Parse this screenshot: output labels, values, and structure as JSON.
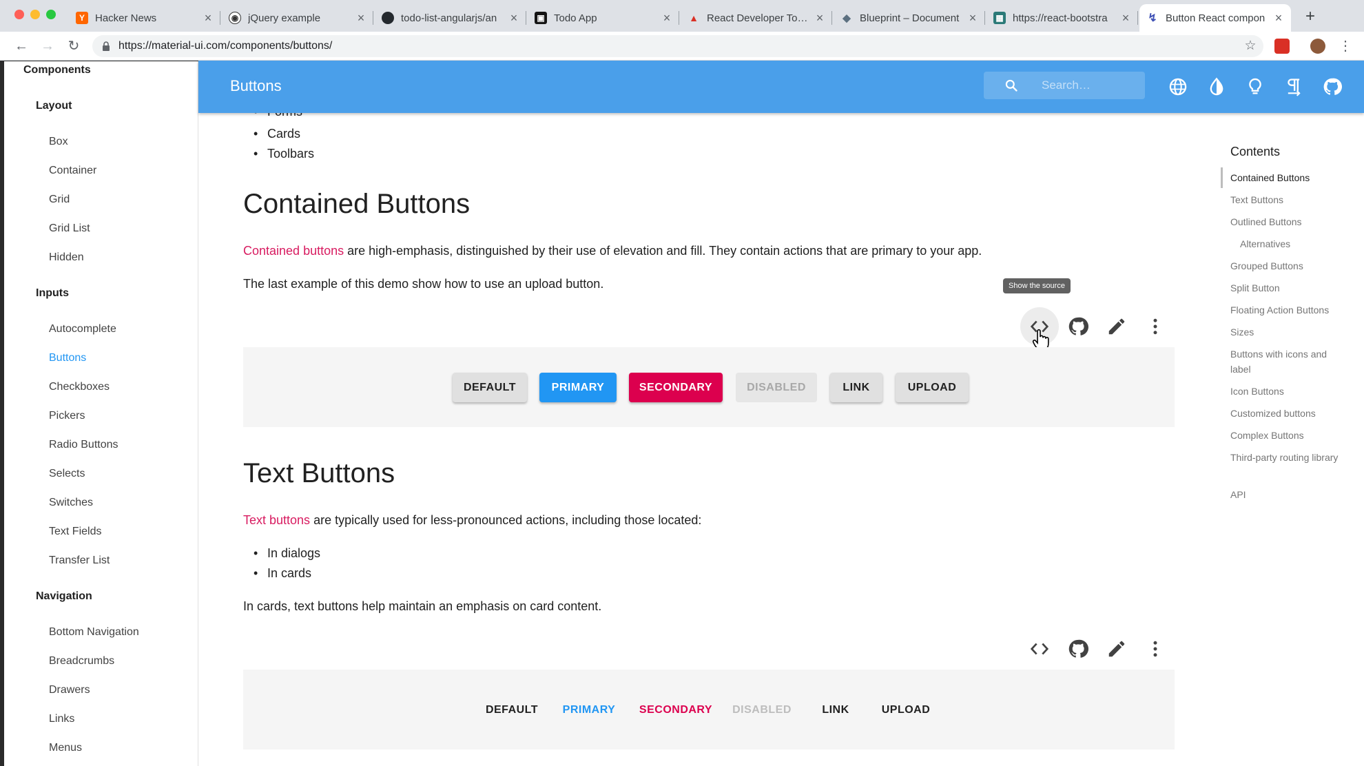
{
  "browser": {
    "tabs": [
      {
        "title": "Hacker News",
        "favicon": "hacker-news-icon",
        "color": "#ff6600",
        "glyph": "Y"
      },
      {
        "title": "jQuery example",
        "favicon": "codepen-icon",
        "color": "#333333",
        "glyph": "◉"
      },
      {
        "title": "todo-list-angularjs/an",
        "favicon": "github-icon",
        "color": "#24292e",
        "glyph": "●"
      },
      {
        "title": "Todo App",
        "favicon": "codesandbox-icon",
        "color": "#151515",
        "glyph": "▣"
      },
      {
        "title": "React Developer Tools",
        "favicon": "chrome-store-icon",
        "color": "#d93025",
        "glyph": "▲"
      },
      {
        "title": "Blueprint – Document",
        "favicon": "blueprint-icon",
        "color": "#5c7080",
        "glyph": "◆"
      },
      {
        "title": "https://react-bootstra",
        "favicon": "react-bootstrap-icon",
        "color": "#2b7a78",
        "glyph": "▦"
      },
      {
        "title": "Button React compon",
        "favicon": "material-ui-icon",
        "color": "#3f51b5",
        "glyph": "↯"
      }
    ],
    "url": "https://material-ui.com/components/buttons/"
  },
  "sidebar": {
    "top_label": "Components",
    "groups": [
      {
        "label": "Layout",
        "items": [
          "Box",
          "Container",
          "Grid",
          "Grid List",
          "Hidden"
        ]
      },
      {
        "label": "Inputs",
        "items": [
          "Autocomplete",
          "Buttons",
          "Checkboxes",
          "Pickers",
          "Radio Buttons",
          "Selects",
          "Switches",
          "Text Fields",
          "Transfer List"
        ]
      },
      {
        "label": "Navigation",
        "items": [
          "Bottom Navigation",
          "Breadcrumbs",
          "Drawers",
          "Links",
          "Menus"
        ]
      }
    ],
    "active_item": "Buttons"
  },
  "appbar": {
    "title": "Buttons",
    "search_placeholder": "Search…",
    "icons": [
      "language-icon",
      "theme-icon",
      "lightbulb-icon",
      "text-direction-icon",
      "github-icon"
    ]
  },
  "content": {
    "partial_bullets": [
      "Forms",
      "Cards",
      "Toolbars"
    ],
    "contained": {
      "heading": "Contained Buttons",
      "link_text": "Contained buttons",
      "desc_rest": " are high-emphasis, distinguished by their use of elevation and fill. They contain actions that are primary to your app.",
      "desc2": "The last example of this demo show how to use an upload button.",
      "tooltip": "Show the source",
      "buttons": [
        "DEFAULT",
        "PRIMARY",
        "SECONDARY",
        "DISABLED",
        "LINK",
        "UPLOAD"
      ]
    },
    "text": {
      "heading": "Text Buttons",
      "link_text": "Text buttons",
      "desc_rest": " are typically used for less-pronounced actions, including those located:",
      "bullets": [
        "In dialogs",
        "In cards"
      ],
      "desc2": "In cards, text buttons help maintain an emphasis on card content.",
      "buttons": [
        "DEFAULT",
        "PRIMARY",
        "SECONDARY",
        "DISABLED",
        "LINK",
        "UPLOAD"
      ]
    },
    "toolbar_icons": [
      "code-icon",
      "github-icon",
      "edit-icon",
      "more-vert-icon"
    ]
  },
  "toc": {
    "title": "Contents",
    "items": [
      "Contained Buttons",
      "Text Buttons",
      "Outlined Buttons",
      "Alternatives",
      "Grouped Buttons",
      "Split Button",
      "Floating Action Buttons",
      "Sizes",
      "Buttons with icons and label",
      "Icon Buttons",
      "Customized buttons",
      "Complex Buttons",
      "Third-party routing library",
      "API"
    ],
    "active": "Contained Buttons"
  },
  "colors": {
    "appbar": "#4a9fea",
    "primary": "#2196f3",
    "secondary": "#dc004e",
    "link": "#d81b60"
  }
}
